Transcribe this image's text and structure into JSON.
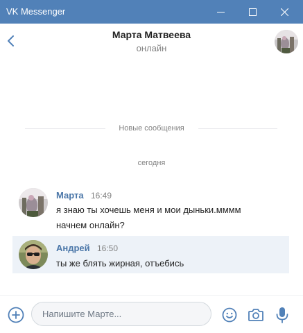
{
  "window": {
    "title": "VK Messenger",
    "title_bar_color": "#5181b8",
    "controls": [
      "minimize-icon",
      "maximize-icon",
      "close-icon"
    ]
  },
  "header": {
    "contact_name": "Марта Матвеева",
    "status": "онлайн",
    "back_icon": "chevron-left-icon",
    "accent_color": "#4a76a8"
  },
  "conversation": {
    "new_messages_divider": "Новые сообщения",
    "date_label": "сегодня",
    "messages": [
      {
        "author": "Марта",
        "time": "16:49",
        "lines": [
          "я знаю ты хочешь меня и мои дыньки.мммм",
          "начнем онлайн?"
        ]
      },
      {
        "author": "Андрей",
        "time": "16:50",
        "lines": [
          "ты же блять жирная, отъебись"
        ],
        "highlighted": true,
        "highlight_color": "#edf2f8"
      }
    ]
  },
  "composer": {
    "placeholder": "Напишите Марте...",
    "value": "",
    "icons": [
      "plus-circle-icon",
      "emoji-icon",
      "camera-icon",
      "microphone-icon"
    ]
  }
}
